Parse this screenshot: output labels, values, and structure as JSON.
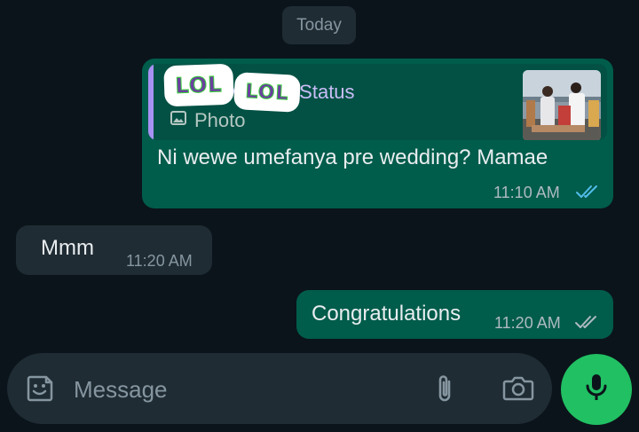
{
  "date_divider": "Today",
  "messages": [
    {
      "direction": "outgoing",
      "quote": {
        "author": "hylis5 Marks • Status",
        "type_label": "Photo",
        "type_icon": "image-icon",
        "stickers": [
          "LOL",
          "LOL"
        ]
      },
      "text": "Ni wewe umefanya pre wedding? Mamae",
      "time": "11:10 AM",
      "status": "read"
    },
    {
      "direction": "incoming",
      "text": "Mmm",
      "time": "11:20 AM"
    },
    {
      "direction": "outgoing",
      "text": "Congratulations",
      "time": "11:20 AM",
      "status": "delivered"
    }
  ],
  "composer": {
    "placeholder": "Message",
    "icons": [
      "sticker-icon",
      "attach-icon",
      "camera-icon",
      "mic-icon"
    ]
  },
  "colors": {
    "background": "#0b141a",
    "outgoing_bubble": "#005c4b",
    "incoming_bubble": "#1f2c34",
    "read_ticks": "#53bdeb",
    "delivered_ticks": "#aebac1",
    "mic_button": "#21c063"
  }
}
